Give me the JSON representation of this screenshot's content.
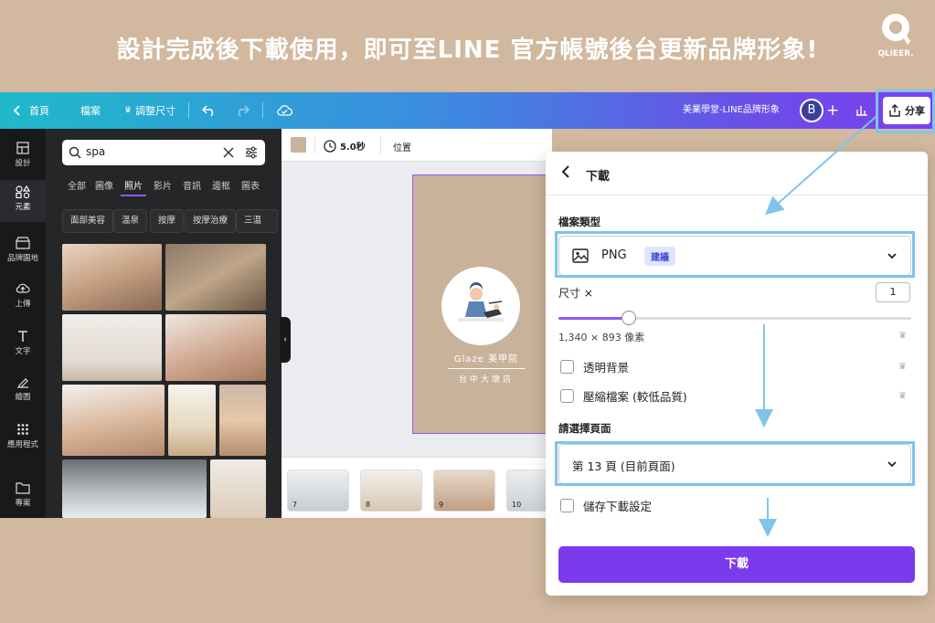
{
  "heading": "設計完成後下載使用，即可至LINE 官方帳號後台更新品牌形象!",
  "logo": {
    "text": "QLiEER."
  },
  "topbar": {
    "home": "首頁",
    "file": "檔案",
    "resize": "調整尺寸",
    "design_title": "美業學堂-LINE品牌形象",
    "avatar_initial": "B",
    "share": "分享"
  },
  "leftrail": [
    {
      "label": "設計",
      "icon": "layout-icon"
    },
    {
      "label": "元素",
      "icon": "elements-icon"
    },
    {
      "label": "品牌園地",
      "icon": "brand-icon"
    },
    {
      "label": "上傳",
      "icon": "upload-icon"
    },
    {
      "label": "文字",
      "icon": "text-icon"
    },
    {
      "label": "繪圖",
      "icon": "draw-icon"
    },
    {
      "label": "應用程式",
      "icon": "apps-icon"
    },
    {
      "label": "專案",
      "icon": "folder-icon"
    }
  ],
  "search": {
    "value": "spa"
  },
  "tabs": [
    "全部",
    "圖像",
    "照片",
    "影片",
    "音訊",
    "邊框",
    "圖表"
  ],
  "chips": [
    "面部美容",
    "溫泉",
    "按摩",
    "按摩治療",
    "三温"
  ],
  "toolbar": {
    "duration": "5.0秒",
    "position": "位置"
  },
  "page_card": {
    "brand": "Glaze 美甲院",
    "branch": "台中大墩店"
  },
  "thumbs": [
    "7",
    "8",
    "9",
    "10"
  ],
  "download": {
    "title": "下載",
    "file_type_label": "檔案類型",
    "file_type": "PNG",
    "recommended": "建議",
    "size_label": "尺寸 ×",
    "size_value": "1",
    "size_fraction": 0.2,
    "dimensions": "1,340 × 893 像素",
    "transparent": "透明背景",
    "compress": "壓縮檔案 (較低品質)",
    "select_pages_label": "請選擇頁面",
    "pages_value": "第 13 頁 (目前頁面)",
    "save_settings": "儲存下載設定",
    "button": "下載"
  },
  "colors": {
    "accent": "#7c3aed",
    "highlight": "#7fc4ea",
    "background": "#d1b89e"
  }
}
